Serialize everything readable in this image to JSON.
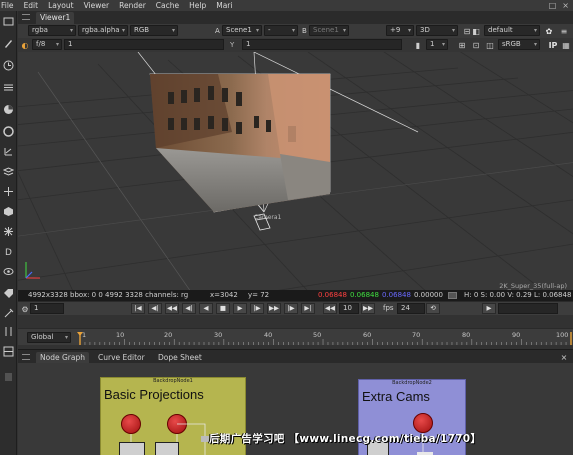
{
  "menu": [
    "File",
    "Edit",
    "Layout",
    "Viewer",
    "Render",
    "Cache",
    "Help",
    "Mari"
  ],
  "window_controls": [
    "□",
    "×"
  ],
  "viewer_tab": "Viewer1",
  "toolbar1": {
    "channels": "rgba",
    "alpha": "rgba.alpha",
    "colorspace": "RGB",
    "input_a_label": "A",
    "input_a": "Scene1",
    "input_mid": "-",
    "input_b_label": "B",
    "input_b": "Scene1",
    "gain": "+9",
    "view_mode": "3D",
    "lut": "default"
  },
  "toolbar2": {
    "proxy": "f/8",
    "frame": "1",
    "y_label": "Y",
    "y_value": "1",
    "zoom": "1",
    "display": "sRGB",
    "ip_label": "IP"
  },
  "viewport": {
    "camera_label": "Camera1",
    "format_info": "2K_Super_35(full-ap)"
  },
  "infobar": {
    "bbox": "4992x3328 bbox: 0 0 4992 3328 channels: rg",
    "x_coord": "x=3042",
    "y_coord": "y= 72",
    "r": "0.06848",
    "g": "0.06848",
    "b": "0.06848",
    "a": "0.00000",
    "hsvl": "H: 0 S: 0.00 V: 0.29  L: 0.06848"
  },
  "playback": {
    "current_frame": "1",
    "step": "10",
    "fps_label": "fps",
    "fps": "24"
  },
  "timeline": {
    "range_mode": "Global",
    "ticks": [
      "1",
      "10",
      "20",
      "30",
      "40",
      "50",
      "60",
      "70",
      "80",
      "90",
      "100"
    ],
    "end_frame": "100"
  },
  "bottom_tabs": [
    "Node Graph",
    "Curve Editor",
    "Dope Sheet"
  ],
  "nodegraph": {
    "backdrop1_header": "BackdropNode1",
    "backdrop1_title": "Basic Projections",
    "backdrop2_header": "BackdropNode2",
    "backdrop2_title": "Extra Cams"
  },
  "watermark": "后期广告学习吧  【www.linecg.com/tieba/1770】",
  "colors": {
    "accent_orange": "#e8a23a",
    "backdrop1": "#b5b54f",
    "backdrop2": "#8f8fd6",
    "red": "#ff4040",
    "green": "#40e040",
    "blue": "#6a6aff"
  }
}
